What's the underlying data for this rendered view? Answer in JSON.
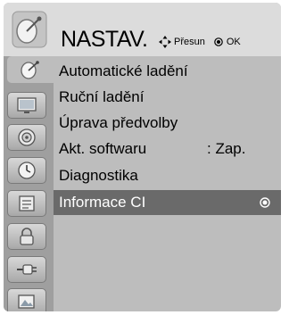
{
  "header": {
    "title": "NASTAV.",
    "move_hint": "Přesun",
    "ok_hint": "OK"
  },
  "menu": {
    "items": [
      {
        "label": "Automatické ladění",
        "value": ""
      },
      {
        "label": "Ruční ladění",
        "value": ""
      },
      {
        "label": "Úprava předvolby",
        "value": ""
      },
      {
        "label": "Akt. softwaru",
        "value": ": Zap."
      },
      {
        "label": "Diagnostika",
        "value": ""
      },
      {
        "label": "Informace CI",
        "value": ""
      }
    ],
    "selected_index": 5
  },
  "rail": {
    "tabs": [
      {
        "icon": "satellite-dish-icon"
      },
      {
        "icon": "screen-icon"
      },
      {
        "icon": "speaker-icon"
      },
      {
        "icon": "clock-icon"
      },
      {
        "icon": "lock-options-icon"
      },
      {
        "icon": "padlock-icon"
      },
      {
        "icon": "input-cable-icon"
      },
      {
        "icon": "photo-icon"
      }
    ],
    "active_index": 0
  },
  "colors": {
    "panel": "#bdbdbd",
    "header": "#dcdcdc",
    "rail": "#9f9f9f",
    "selection": "#6a6a6a"
  }
}
